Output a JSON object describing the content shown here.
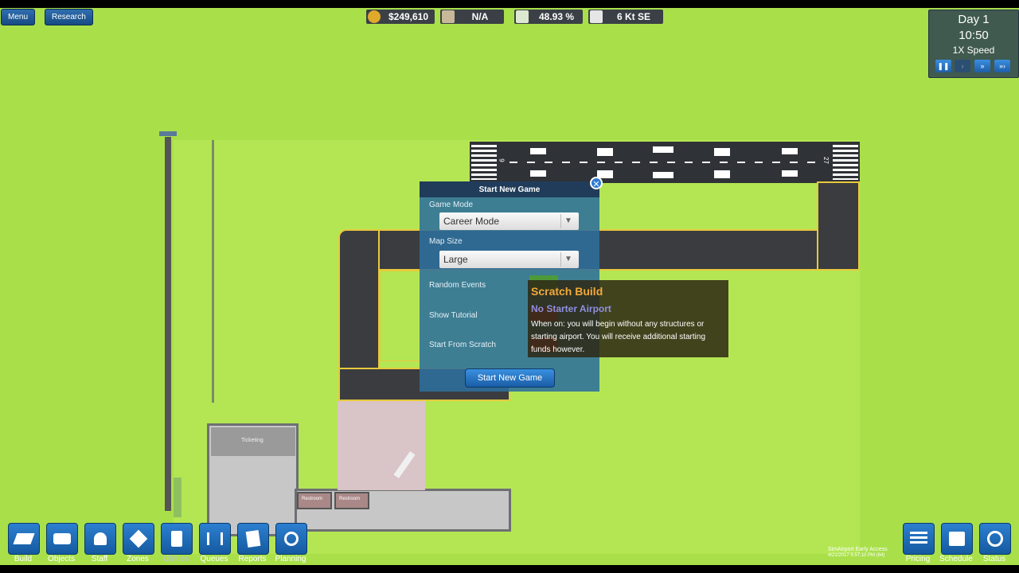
{
  "topbar": {
    "menu_label": "Menu",
    "research_label": "Research"
  },
  "hud": {
    "money": "$249,610",
    "rating": "N/A",
    "percent": "48.93 %",
    "wind": "6 Kt SE",
    "money_icon": "coin-icon",
    "rating_icon": "passenger-icon",
    "percent_icon": "plane-icon",
    "wind_icon": "weather-icon"
  },
  "clock": {
    "day": "Day 1",
    "time": "10:50",
    "speed": "1X Speed"
  },
  "runway": {
    "label_left": "9",
    "label_right": "27"
  },
  "map": {
    "ticketing_label": "Ticketing",
    "restroom_labels": [
      "Restroom",
      "Restroom"
    ]
  },
  "dialog": {
    "title": "Start New Game",
    "game_mode_label": "Game Mode",
    "game_mode_value": "Career Mode",
    "map_size_label": "Map Size",
    "map_size_value": "Large",
    "random_events_label": "Random Events",
    "show_tutorial_label": "Show Tutorial",
    "start_from_scratch_label": "Start From Scratch",
    "start_button_label": "Start New Game"
  },
  "tooltip": {
    "title": "Scratch Build",
    "subtitle": "No Starter Airport",
    "body": "When on:  you will begin without any structures or starting airport.  You will receive additional starting funds however."
  },
  "toolbar_left": [
    {
      "label": "Build",
      "icon": "plane-build-icon"
    },
    {
      "label": "Objects",
      "icon": "sofa-icon"
    },
    {
      "label": "Staff",
      "icon": "staff-icon"
    },
    {
      "label": "Zones",
      "icon": "zones-icon"
    },
    {
      "label": "Utilities",
      "icon": "fuel-icon"
    },
    {
      "label": "Queues",
      "icon": "queue-icon"
    },
    {
      "label": "Reports",
      "icon": "report-icon"
    },
    {
      "label": "Planning",
      "icon": "compass-icon"
    }
  ],
  "toolbar_right": [
    {
      "label": "Pricing",
      "icon": "pricing-icon"
    },
    {
      "label": "Schedule",
      "icon": "calendar-icon"
    },
    {
      "label": "Status",
      "icon": "status-icon"
    }
  ],
  "version": {
    "line1": "SimAirport Early Access",
    "line2": "4/21/2017 5:57:10 PM (64)"
  }
}
